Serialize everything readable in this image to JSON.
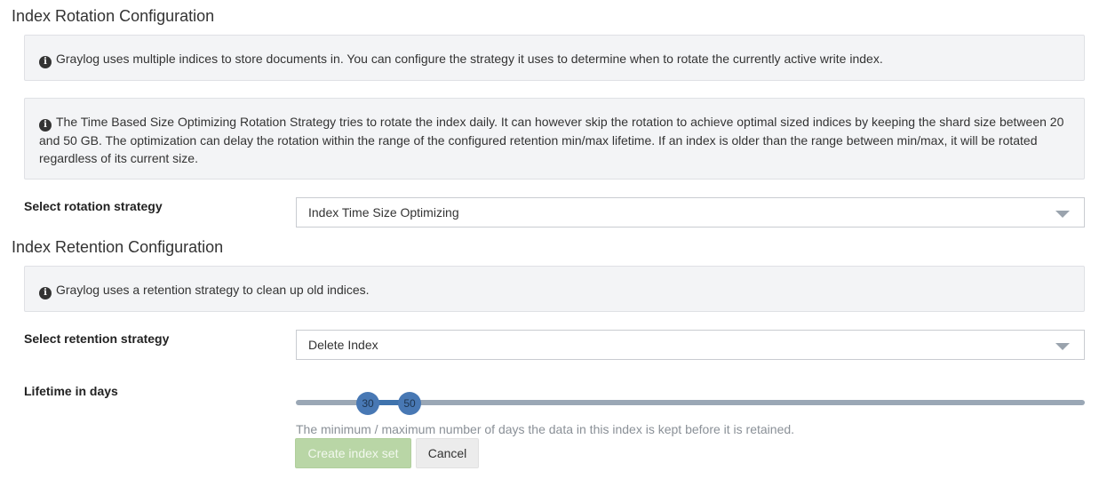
{
  "rotation": {
    "title": "Index Rotation Configuration",
    "info": "Graylog uses multiple indices to store documents in. You can configure the strategy it uses to determine when to rotate the currently active write index.",
    "strategy_info": "The Time Based Size Optimizing Rotation Strategy tries to rotate the index daily. It can however skip the rotation to achieve optimal sized indices by keeping the shard size between 20 and 50 GB. The optimization can delay the rotation within the range of the configured retention min/max lifetime. If an index is older than the range between min/max, it will be rotated regardless of its current size.",
    "select_label": "Select rotation strategy",
    "select_value": "Index Time Size Optimizing"
  },
  "retention": {
    "title": "Index Retention Configuration",
    "info": "Graylog uses a retention strategy to clean up old indices.",
    "select_label": "Select retention strategy",
    "select_value": "Delete Index"
  },
  "lifetime": {
    "label": "Lifetime in days",
    "min": "30",
    "max": "50",
    "help": "The minimum / maximum number of days the data in this index is kept before it is retained."
  },
  "actions": {
    "create": "Create index set",
    "cancel": "Cancel"
  },
  "icons": {
    "info": "info-icon",
    "dropdown": "caret-down-icon"
  },
  "colors": {
    "primary_button": "#b9d6a6",
    "slider_handle": "#4878b4",
    "slider_track": "#9aa7b5"
  }
}
